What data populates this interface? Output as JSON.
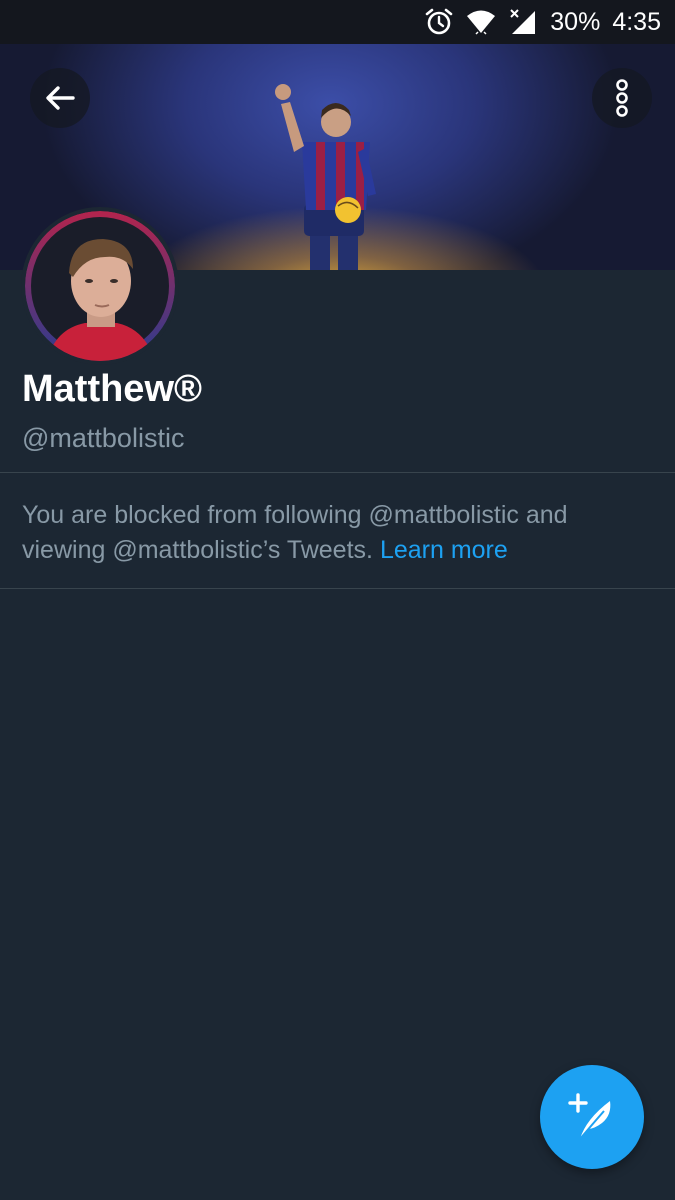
{
  "status_bar": {
    "battery": "30%",
    "time": "4:35",
    "icons": [
      "alarm-icon",
      "wifi-icon",
      "signal-icon"
    ]
  },
  "header": {
    "back_icon": "arrow-left-icon",
    "more_icon": "more-vertical-icon"
  },
  "profile": {
    "name": "Matthew®",
    "handle": "@mattbolistic"
  },
  "blocked_notice": {
    "text": "You are blocked from following @mattbolistic and viewing @mattbolistic’s Tweets.",
    "link_label": "Learn more"
  },
  "fab": {
    "icon": "compose-tweet-icon"
  },
  "colors": {
    "background": "#1c2733",
    "divider": "#38444d",
    "secondary_text": "#8899a6",
    "accent": "#1da1f2",
    "status_bar": "#14171e"
  }
}
